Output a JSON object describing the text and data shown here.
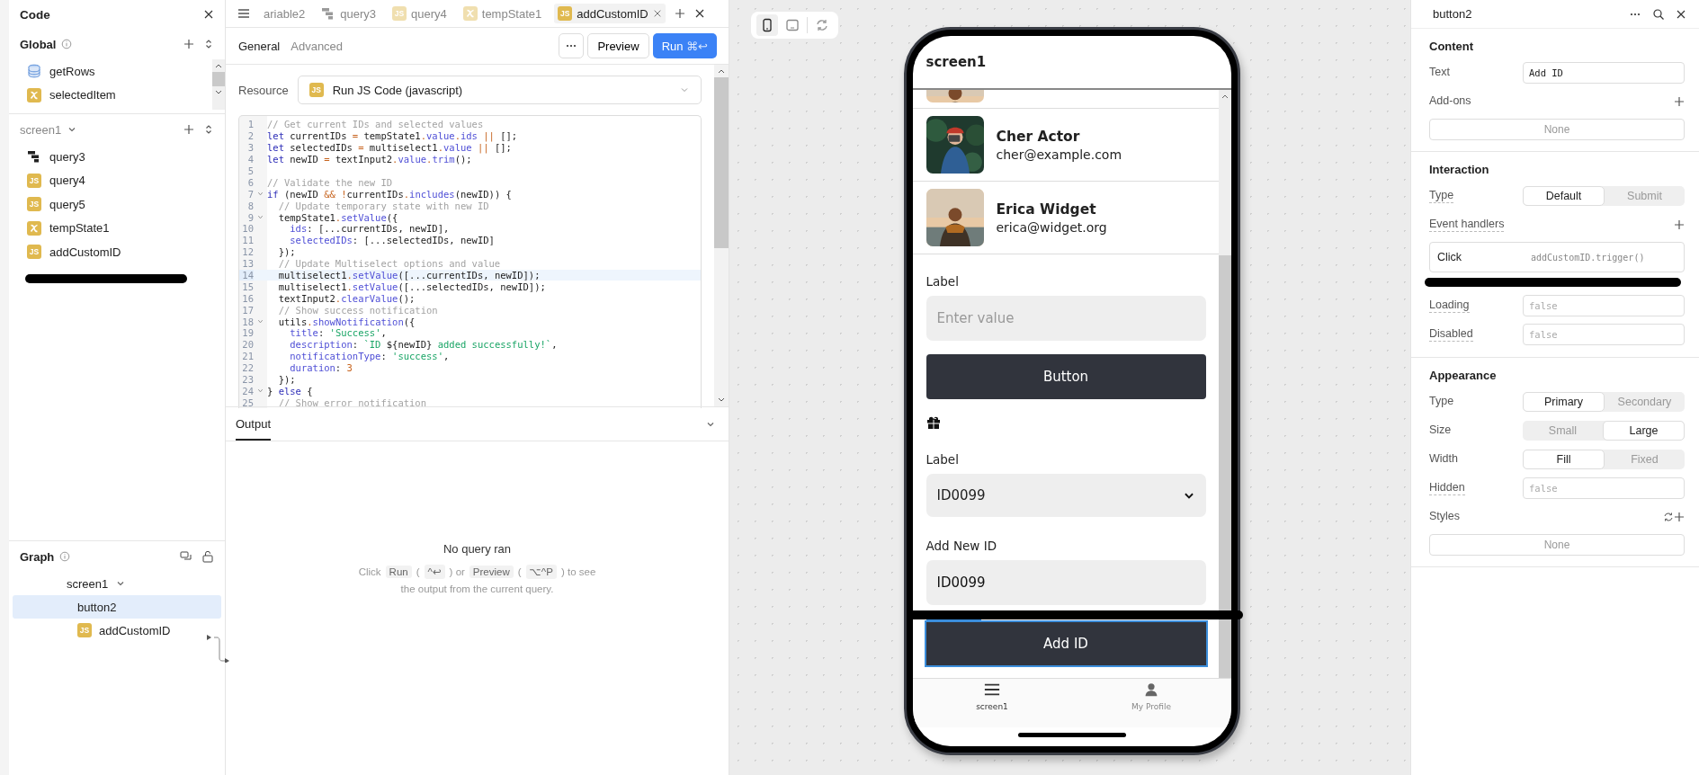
{
  "code_panel": {
    "title": "Code",
    "global": {
      "title": "Global",
      "items": [
        {
          "label": "getRows",
          "kind": "database"
        },
        {
          "label": "selectedItem",
          "kind": "variable"
        }
      ]
    },
    "screen": {
      "title": "screen1",
      "items": [
        {
          "label": "query3",
          "kind": "workflow"
        },
        {
          "label": "query4",
          "kind": "js",
          "badge": "JS"
        },
        {
          "label": "query5",
          "kind": "js",
          "badge": "JS"
        },
        {
          "label": "tempState1",
          "kind": "variable"
        },
        {
          "label": "addCustomID",
          "kind": "js",
          "badge": "JS"
        }
      ]
    }
  },
  "graph": {
    "title": "Graph",
    "nodes": [
      {
        "label": "screen1",
        "kind": "screen",
        "selected": false,
        "children": [
          {
            "label": "button2",
            "kind": "component",
            "selected": true,
            "children": [
              {
                "label": "addCustomID",
                "kind": "js",
                "badge": "JS",
                "selected": false
              }
            ]
          }
        ]
      }
    ]
  },
  "editor_tabs": [
    {
      "label": "ariable2",
      "kind": "none",
      "selected": false
    },
    {
      "label": "query3",
      "kind": "workflow",
      "selected": false
    },
    {
      "label": "query4",
      "kind": "js",
      "badge": "JS",
      "selected": false
    },
    {
      "label": "tempState1",
      "kind": "variable",
      "selected": false
    },
    {
      "label": "addCustomID",
      "kind": "js",
      "badge": "JS",
      "selected": true
    }
  ],
  "query": {
    "tabs": [
      {
        "label": "General",
        "selected": true
      },
      {
        "label": "Advanced",
        "selected": false
      }
    ],
    "preview_button": "Preview",
    "run_button": {
      "label": "Run",
      "shortcut": "⌘↩"
    },
    "resource": {
      "label": "Resource",
      "badge": "JS",
      "value": "Run JS Code (javascript)"
    },
    "code_lines": [
      {
        "number": "1",
        "fold": false,
        "highlighted": false,
        "tokens": [
          {
            "kind": "comment",
            "text": "// Get current IDs and selected values"
          }
        ]
      },
      {
        "number": "2",
        "fold": false,
        "highlighted": false,
        "tokens": [
          {
            "kind": "keyword",
            "text": "let"
          },
          {
            "kind": "plain",
            "text": " currentIDs "
          },
          {
            "kind": "operator",
            "text": "="
          },
          {
            "kind": "plain",
            "text": " tempState1"
          },
          {
            "kind": "operator",
            "text": "."
          },
          {
            "kind": "property",
            "text": "value"
          },
          {
            "kind": "operator",
            "text": "."
          },
          {
            "kind": "property",
            "text": "ids"
          },
          {
            "kind": "operator",
            "text": " ||"
          },
          {
            "kind": "plain",
            "text": " [];"
          }
        ]
      },
      {
        "number": "3",
        "fold": false,
        "highlighted": false,
        "tokens": [
          {
            "kind": "keyword",
            "text": "let"
          },
          {
            "kind": "plain",
            "text": " selectedIDs "
          },
          {
            "kind": "operator",
            "text": "="
          },
          {
            "kind": "plain",
            "text": " multiselect1"
          },
          {
            "kind": "operator",
            "text": "."
          },
          {
            "kind": "property",
            "text": "value"
          },
          {
            "kind": "operator",
            "text": " ||"
          },
          {
            "kind": "plain",
            "text": " [];"
          }
        ]
      },
      {
        "number": "4",
        "fold": false,
        "highlighted": false,
        "tokens": [
          {
            "kind": "keyword",
            "text": "let"
          },
          {
            "kind": "plain",
            "text": " newID "
          },
          {
            "kind": "operator",
            "text": "="
          },
          {
            "kind": "plain",
            "text": " textInput2"
          },
          {
            "kind": "operator",
            "text": "."
          },
          {
            "kind": "property",
            "text": "value"
          },
          {
            "kind": "operator",
            "text": "."
          },
          {
            "kind": "property",
            "text": "trim"
          },
          {
            "kind": "plain",
            "text": "();"
          }
        ]
      },
      {
        "number": "5",
        "fold": false,
        "highlighted": false
      },
      {
        "number": "6",
        "fold": false,
        "highlighted": false,
        "tokens": [
          {
            "kind": "comment",
            "text": "// Validate the new ID"
          }
        ]
      },
      {
        "number": "7",
        "fold": true,
        "highlighted": false,
        "tokens": [
          {
            "kind": "keyword",
            "text": "if"
          },
          {
            "kind": "plain",
            "text": " (newID "
          },
          {
            "kind": "operator",
            "text": "&& !"
          },
          {
            "kind": "plain",
            "text": "currentIDs"
          },
          {
            "kind": "operator",
            "text": "."
          },
          {
            "kind": "property",
            "text": "includes"
          },
          {
            "kind": "plain",
            "text": "(newID)) {"
          }
        ]
      },
      {
        "number": "8",
        "fold": false,
        "highlighted": false,
        "tokens": [
          {
            "kind": "comment",
            "text": "  // Update temporary state with new ID"
          }
        ]
      },
      {
        "number": "9",
        "fold": true,
        "highlighted": false,
        "tokens": [
          {
            "kind": "plain",
            "text": "  tempState1"
          },
          {
            "kind": "operator",
            "text": "."
          },
          {
            "kind": "property",
            "text": "setValue"
          },
          {
            "kind": "plain",
            "text": "({"
          }
        ]
      },
      {
        "number": "10",
        "fold": false,
        "highlighted": false,
        "tokens": [
          {
            "kind": "property",
            "text": "    ids"
          },
          {
            "kind": "plain",
            "text": ": [...currentIDs, newID],"
          }
        ]
      },
      {
        "number": "11",
        "fold": false,
        "highlighted": false,
        "tokens": [
          {
            "kind": "property",
            "text": "    selectedIDs"
          },
          {
            "kind": "plain",
            "text": ": [...selectedIDs, newID]"
          }
        ]
      },
      {
        "number": "12",
        "fold": false,
        "highlighted": false,
        "tokens": [
          {
            "kind": "plain",
            "text": "  });"
          }
        ]
      },
      {
        "number": "13",
        "fold": false,
        "highlighted": false,
        "tokens": [
          {
            "kind": "comment",
            "text": "  // Update Multiselect options and value"
          }
        ]
      },
      {
        "number": "14",
        "fold": false,
        "highlighted": true,
        "tokens": [
          {
            "kind": "plain",
            "text": "  multiselect1"
          },
          {
            "kind": "operator",
            "text": "."
          },
          {
            "kind": "property",
            "text": "setValue"
          },
          {
            "kind": "plain",
            "text": "([...currentIDs, newID]);"
          }
        ]
      },
      {
        "number": "15",
        "fold": false,
        "highlighted": false,
        "tokens": [
          {
            "kind": "plain",
            "text": "  multiselect1"
          },
          {
            "kind": "operator",
            "text": "."
          },
          {
            "kind": "property",
            "text": "setValue"
          },
          {
            "kind": "plain",
            "text": "([...selectedIDs, newID]);"
          }
        ]
      },
      {
        "number": "16",
        "fold": false,
        "highlighted": false,
        "tokens": [
          {
            "kind": "plain",
            "text": "  textInput2"
          },
          {
            "kind": "operator",
            "text": "."
          },
          {
            "kind": "property",
            "text": "clearValue"
          },
          {
            "kind": "plain",
            "text": "();"
          }
        ]
      },
      {
        "number": "17",
        "fold": false,
        "highlighted": false,
        "tokens": [
          {
            "kind": "comment",
            "text": "  // Show success notification"
          }
        ]
      },
      {
        "number": "18",
        "fold": true,
        "highlighted": false,
        "tokens": [
          {
            "kind": "plain",
            "text": "  utils"
          },
          {
            "kind": "operator",
            "text": "."
          },
          {
            "kind": "property",
            "text": "showNotification"
          },
          {
            "kind": "plain",
            "text": "({"
          }
        ]
      },
      {
        "number": "19",
        "fold": false,
        "highlighted": false,
        "tokens": [
          {
            "kind": "property",
            "text": "    title"
          },
          {
            "kind": "plain",
            "text": ":"
          },
          {
            "kind": "string",
            "text": " 'Success'"
          },
          {
            "kind": "plain",
            "text": ","
          }
        ]
      },
      {
        "number": "20",
        "fold": false,
        "highlighted": false,
        "tokens": [
          {
            "kind": "property",
            "text": "    description"
          },
          {
            "kind": "plain",
            "text": ":"
          },
          {
            "kind": "string",
            "text": " `ID"
          },
          {
            "kind": "plain",
            "text": " ${newID}"
          },
          {
            "kind": "string",
            "text": " added successfully!`"
          },
          {
            "kind": "plain",
            "text": ","
          }
        ]
      },
      {
        "number": "21",
        "fold": false,
        "highlighted": false,
        "tokens": [
          {
            "kind": "property",
            "text": "    notificationType"
          },
          {
            "kind": "plain",
            "text": ":"
          },
          {
            "kind": "string",
            "text": " 'success'"
          },
          {
            "kind": "plain",
            "text": ","
          }
        ]
      },
      {
        "number": "22",
        "fold": false,
        "highlighted": false,
        "tokens": [
          {
            "kind": "property",
            "text": "    duration"
          },
          {
            "kind": "plain",
            "text": ":"
          },
          {
            "kind": "number",
            "text": " 3"
          }
        ]
      },
      {
        "number": "23",
        "fold": false,
        "highlighted": false,
        "tokens": [
          {
            "kind": "plain",
            "text": "  });"
          }
        ]
      },
      {
        "number": "24",
        "fold": true,
        "highlighted": false,
        "tokens": [
          {
            "kind": "plain",
            "text": "}"
          },
          {
            "kind": "keyword",
            "text": " else"
          },
          {
            "kind": "plain",
            "text": " {"
          }
        ]
      },
      {
        "number": "25",
        "fold": false,
        "highlighted": false,
        "tokens": [
          {
            "kind": "comment",
            "text": "  // Show error notification"
          }
        ]
      }
    ]
  },
  "output": {
    "tab": "Output",
    "empty_title": "No query ran",
    "help": [
      {
        "kind": "text",
        "text": "Click"
      },
      {
        "kind": "key",
        "text": "Run"
      },
      {
        "kind": "text",
        "text": "("
      },
      {
        "kind": "key",
        "text": "^↩"
      },
      {
        "kind": "text",
        "text": ") or"
      },
      {
        "kind": "key",
        "text": "Preview"
      },
      {
        "kind": "text",
        "text": "("
      },
      {
        "kind": "key",
        "text": "⌥^P"
      },
      {
        "kind": "text",
        "text": ") to see"
      }
    ],
    "help_line2": "the output from the current query."
  },
  "canvas_toolbar": [
    {
      "kind": "mobile",
      "selected": true
    },
    {
      "kind": "desktop",
      "selected": false
    },
    {
      "kind": "rotate",
      "selected": false
    }
  ],
  "phone": {
    "title": "screen1",
    "contacts": [
      {
        "name": "Cher Actor",
        "email": "cher@example.com",
        "kind": "picture"
      },
      {
        "name": "Erica Widget",
        "email": "erica@widget.org",
        "kind": "picture"
      }
    ],
    "text_input": {
      "label": "Label",
      "placeholder": "Enter value"
    },
    "button": "Button",
    "select": {
      "label": "Label",
      "value": "ID0099"
    },
    "id_input": {
      "label": "Add New ID",
      "value": "ID0099"
    },
    "add_button": {
      "label": "Add ID",
      "selected": true
    },
    "nav": [
      {
        "label": "screen1",
        "kind": "menu",
        "selected": true
      },
      {
        "label": "My Profile",
        "kind": "person",
        "selected": false
      }
    ]
  },
  "inspector": {
    "title": "button2",
    "sections": [
      {
        "title": "Content",
        "rows": [
          {
            "kind": "field",
            "label": "Text",
            "value": "Add ID",
            "underlined": false
          },
          {
            "kind": "header",
            "label": "Add-ons",
            "actions": [
              {
                "kind": "add"
              }
            ],
            "underlined": false
          },
          {
            "kind": "empty",
            "text": "None"
          }
        ]
      },
      {
        "title": "Interaction",
        "rows": [
          {
            "kind": "segmented",
            "label": "Type",
            "underlined": true,
            "options": [
              {
                "label": "Default",
                "selected": true
              },
              {
                "label": "Submit",
                "selected": false
              }
            ]
          },
          {
            "kind": "header",
            "label": "Event handlers",
            "actions": [
              {
                "kind": "add"
              }
            ],
            "underlined": true
          },
          {
            "kind": "handler",
            "event": "Click",
            "action": "addCustomID.trigger()"
          },
          {
            "kind": "field",
            "label": "Loading",
            "placeholder": "false",
            "underlined": true
          },
          {
            "kind": "field",
            "label": "Disabled",
            "placeholder": "false",
            "underlined": true
          }
        ]
      },
      {
        "title": "Appearance",
        "rows": [
          {
            "kind": "segmented",
            "label": "Type",
            "underlined": false,
            "options": [
              {
                "label": "Primary",
                "selected": true
              },
              {
                "label": "Secondary",
                "selected": false
              }
            ]
          },
          {
            "kind": "segmented",
            "label": "Size",
            "underlined": false,
            "options": [
              {
                "label": "Small",
                "selected": false
              },
              {
                "label": "Large",
                "selected": true
              }
            ]
          },
          {
            "kind": "segmented",
            "label": "Width",
            "underlined": false,
            "options": [
              {
                "label": "Fill",
                "selected": true
              },
              {
                "label": "Fixed",
                "selected": false
              }
            ]
          },
          {
            "kind": "field",
            "label": "Hidden",
            "placeholder": "false",
            "underlined": true
          },
          {
            "kind": "header",
            "label": "Styles",
            "actions": [
              {
                "kind": "refresh"
              },
              {
                "kind": "add"
              }
            ],
            "underlined": false
          },
          {
            "kind": "empty",
            "text": "None"
          }
        ]
      }
    ]
  }
}
